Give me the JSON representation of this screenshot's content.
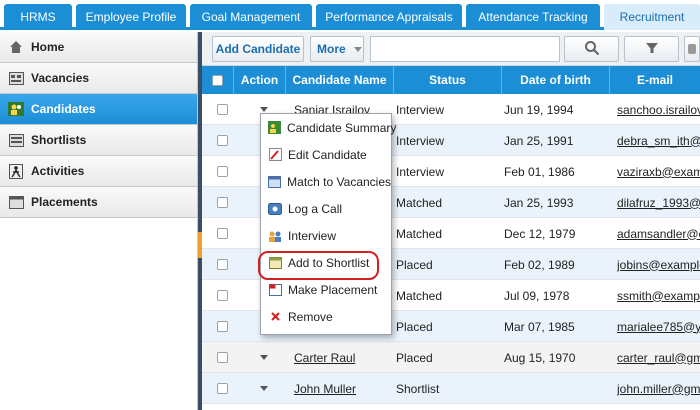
{
  "tabs": [
    {
      "label": "HRMS"
    },
    {
      "label": "Employee Profile"
    },
    {
      "label": "Goal Management"
    },
    {
      "label": "Performance Appraisals"
    },
    {
      "label": "Attendance Tracking"
    },
    {
      "label": "Recruitment"
    }
  ],
  "sidebar": {
    "items": [
      {
        "label": "Home",
        "icon": "home-icon"
      },
      {
        "label": "Vacancies",
        "icon": "vacancies-icon"
      },
      {
        "label": "Candidates",
        "icon": "candidates-icon"
      },
      {
        "label": "Shortlists",
        "icon": "shortlists-icon"
      },
      {
        "label": "Activities",
        "icon": "activities-icon"
      },
      {
        "label": "Placements",
        "icon": "placements-icon"
      }
    ]
  },
  "toolbar": {
    "add_label": "Add Candidate",
    "more_label": "More",
    "search_value": ""
  },
  "grid": {
    "columns": [
      "Action",
      "Candidate Name",
      "Status",
      "Date of birth",
      "E-mail"
    ],
    "rows": [
      {
        "name": "Sanjar Israilov",
        "status": "Interview",
        "dob": "Jun 19, 1994",
        "email": "sanchoo.israilov"
      },
      {
        "name": "",
        "status": "Interview",
        "dob": "Jan 25, 1991",
        "email": "debra_sm_ith@e"
      },
      {
        "name": "",
        "status": "Interview",
        "dob": "Feb 01, 1986",
        "email": "vaziraxb@examp"
      },
      {
        "name": "",
        "status": "Matched",
        "dob": "Jan 25, 1993",
        "email": "dilafruz_1993@e"
      },
      {
        "name": "",
        "status": "Matched",
        "dob": "Dec 12, 1979",
        "email": "adamsandler@e"
      },
      {
        "name": "",
        "status": "Placed",
        "dob": "Feb 02, 1989",
        "email": "jobins@example"
      },
      {
        "name": "",
        "status": "Matched",
        "dob": "Jul 09, 1978",
        "email": "ssmith@example"
      },
      {
        "name": "",
        "status": "Placed",
        "dob": "Mar 07, 1985",
        "email": "marialee785@ya"
      },
      {
        "name": "Carter Raul",
        "status": "Placed",
        "dob": "Aug 15, 1970",
        "email": "carter_raul@gma"
      },
      {
        "name": "John Muller",
        "status": "Shortlist",
        "dob": "",
        "email": "john.miller@gma"
      }
    ]
  },
  "context_menu": {
    "items": [
      {
        "label": "Candidate Summary",
        "icon": "summary-icon"
      },
      {
        "label": "Edit Candidate",
        "icon": "edit-icon"
      },
      {
        "label": "Match to Vacancies",
        "icon": "match-icon"
      },
      {
        "label": "Log a Call",
        "icon": "phone-icon"
      },
      {
        "label": "Interview",
        "icon": "interview-icon"
      },
      {
        "label": "Add to Shortlist",
        "icon": "shortlist-add-icon"
      },
      {
        "label": "Make Placement",
        "icon": "placement-icon"
      },
      {
        "label": "Remove",
        "icon": "remove-icon"
      }
    ]
  },
  "colors": {
    "accent": "#1b8ed6",
    "highlight_ring": "#d42020"
  }
}
